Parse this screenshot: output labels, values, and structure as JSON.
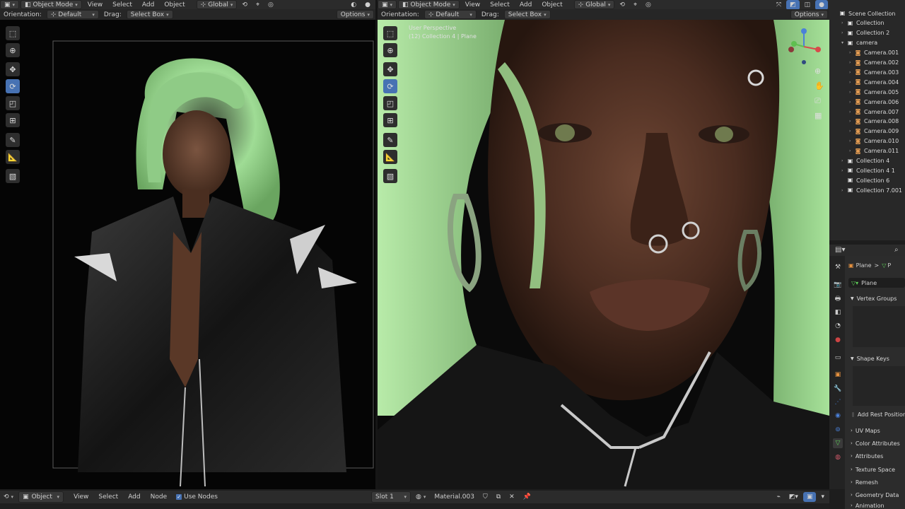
{
  "left_view": {
    "mode": "Object Mode",
    "menus": [
      "View",
      "Select",
      "Add",
      "Object"
    ],
    "transform": "Global",
    "orientation_label": "Orientation:",
    "orientation_value": "Default",
    "drag_label": "Drag:",
    "drag_value": "Select Box",
    "options": "Options"
  },
  "right_view": {
    "mode": "Object Mode",
    "menus": [
      "View",
      "Select",
      "Add",
      "Object"
    ],
    "transform": "Global",
    "orientation_label": "Orientation:",
    "orientation_value": "Default",
    "drag_label": "Drag:",
    "drag_value": "Select Box",
    "options": "Options",
    "overlay_line1": "User Perspective",
    "overlay_line2": "(12) Collection 4 | Plane"
  },
  "outliner": {
    "items": [
      {
        "label": "Scene Collection",
        "indent": 0,
        "icon": "collection",
        "tri": ""
      },
      {
        "label": "Collection",
        "indent": 1,
        "icon": "collection",
        "tri": ">"
      },
      {
        "label": "Collection 2",
        "indent": 1,
        "icon": "collection",
        "tri": ">"
      },
      {
        "label": "camera",
        "indent": 1,
        "icon": "collection",
        "tri": "v"
      },
      {
        "label": "Camera.001",
        "indent": 2,
        "icon": "camera",
        "tri": ">"
      },
      {
        "label": "Camera.002",
        "indent": 2,
        "icon": "camera",
        "tri": ">"
      },
      {
        "label": "Camera.003",
        "indent": 2,
        "icon": "camera",
        "tri": ">"
      },
      {
        "label": "Camera.004",
        "indent": 2,
        "icon": "camera",
        "tri": ">"
      },
      {
        "label": "Camera.005",
        "indent": 2,
        "icon": "camera",
        "tri": ">"
      },
      {
        "label": "Camera.006",
        "indent": 2,
        "icon": "camera",
        "tri": ">"
      },
      {
        "label": "Camera.007",
        "indent": 2,
        "icon": "camera",
        "tri": ">"
      },
      {
        "label": "Camera.008",
        "indent": 2,
        "icon": "camera",
        "tri": ">"
      },
      {
        "label": "Camera.009",
        "indent": 2,
        "icon": "camera",
        "tri": ">"
      },
      {
        "label": "Camera.010",
        "indent": 2,
        "icon": "camera",
        "tri": ">"
      },
      {
        "label": "Camera.011",
        "indent": 2,
        "icon": "camera",
        "tri": ">"
      },
      {
        "label": "Collection 4",
        "indent": 1,
        "icon": "collection",
        "tri": ">"
      },
      {
        "label": "Collection 4 1",
        "indent": 1,
        "icon": "collection",
        "tri": ">"
      },
      {
        "label": "Collection 6",
        "indent": 1,
        "icon": "collection",
        "tri": ""
      },
      {
        "label": "Collection 7.001",
        "indent": 1,
        "icon": "collection",
        "tri": ">"
      }
    ]
  },
  "properties": {
    "breadcrumb_object": "Plane",
    "breadcrumb_sep": ">",
    "breadcrumb_data": "P",
    "mesh_name": "Plane",
    "vertex_groups": "Vertex Groups",
    "shape_keys": "Shape Keys",
    "add_rest_position": "Add Rest Position",
    "uv_maps": "UV Maps",
    "color_attributes": "Color Attributes",
    "attributes": "Attributes",
    "texture_space": "Texture Space",
    "remesh": "Remesh",
    "geometry_data": "Geometry Data",
    "animation": "Animation"
  },
  "node_header": {
    "object_type": "Object",
    "menus": [
      "View",
      "Select",
      "Add",
      "Node"
    ],
    "use_nodes": "Use Nodes",
    "slot": "Slot 1",
    "material": "Material.003"
  },
  "colors": {
    "accent": "#4772b3",
    "header": "#2b2b2b",
    "panel": "#232323",
    "hair_green": "#9fdc95",
    "camera_icon": "#e49c52"
  }
}
